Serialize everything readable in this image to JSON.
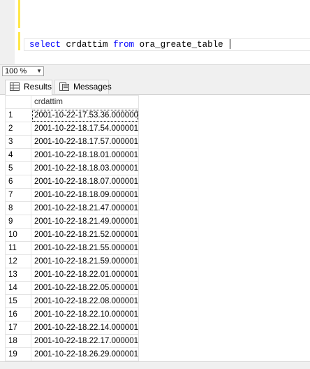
{
  "editor": {
    "query": {
      "select_kw": "select",
      "column": "crdattim",
      "from_kw": "from",
      "table": "ora_greate_table"
    }
  },
  "zoom": {
    "value": "100 %"
  },
  "tabs": [
    {
      "label": "Results"
    },
    {
      "label": "Messages"
    }
  ],
  "grid": {
    "header": "crdattim",
    "rows": [
      {
        "n": "1",
        "v": "2001-10-22-17.53.36.000000"
      },
      {
        "n": "2",
        "v": "2001-10-22-18.17.54.000001"
      },
      {
        "n": "3",
        "v": "2001-10-22-18.17.57.000001"
      },
      {
        "n": "4",
        "v": "2001-10-22-18.18.01.000001"
      },
      {
        "n": "5",
        "v": "2001-10-22-18.18.03.000001"
      },
      {
        "n": "6",
        "v": "2001-10-22-18.18.07.000001"
      },
      {
        "n": "7",
        "v": "2001-10-22-18.18.09.000001"
      },
      {
        "n": "8",
        "v": "2001-10-22-18.21.47.000001"
      },
      {
        "n": "9",
        "v": "2001-10-22-18.21.49.000001"
      },
      {
        "n": "10",
        "v": "2001-10-22-18.21.52.000001"
      },
      {
        "n": "11",
        "v": "2001-10-22-18.21.55.000001"
      },
      {
        "n": "12",
        "v": "2001-10-22-18.21.59.000001"
      },
      {
        "n": "13",
        "v": "2001-10-22-18.22.01.000001"
      },
      {
        "n": "14",
        "v": "2001-10-22-18.22.05.000001"
      },
      {
        "n": "15",
        "v": "2001-10-22-18.22.08.000001"
      },
      {
        "n": "16",
        "v": "2001-10-22-18.22.10.000001"
      },
      {
        "n": "17",
        "v": "2001-10-22-18.22.14.000001"
      },
      {
        "n": "18",
        "v": "2001-10-22-18.22.17.000001"
      },
      {
        "n": "19",
        "v": "2001-10-22-18.26.29.000001"
      }
    ]
  },
  "colors": {
    "keyword": "#0000ff",
    "change_bar": "#ffe74a"
  }
}
